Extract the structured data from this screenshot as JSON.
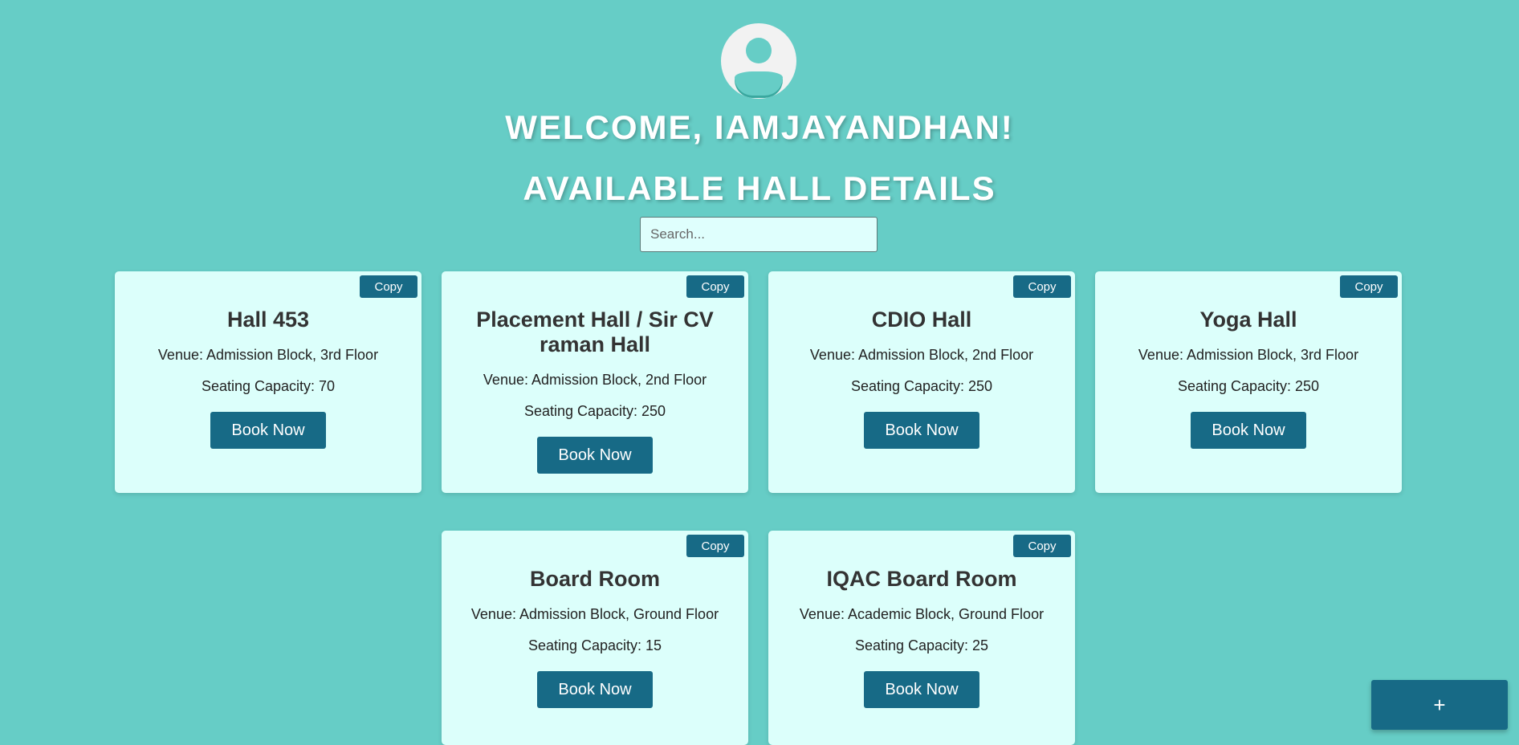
{
  "header": {
    "welcome": "WELCOME, IAMJAYANDHAN!",
    "subtitle": "AVAILABLE HALL DETAILS"
  },
  "search": {
    "placeholder": "Search...",
    "value": ""
  },
  "halls": [
    {
      "name": "Hall 453",
      "venue": "Venue: Admission Block, 3rd Floor",
      "capacity": "Seating Capacity: 70",
      "copy_label": "Copy",
      "book_label": "Book Now"
    },
    {
      "name": "Placement Hall / Sir CV raman Hall",
      "venue": "Venue: Admission Block, 2nd Floor",
      "capacity": "Seating Capacity: 250",
      "copy_label": "Copy",
      "book_label": "Book Now"
    },
    {
      "name": "CDIO Hall",
      "venue": "Venue: Admission Block, 2nd Floor",
      "capacity": "Seating Capacity: 250",
      "copy_label": "Copy",
      "book_label": "Book Now"
    },
    {
      "name": "Yoga Hall",
      "venue": "Venue: Admission Block, 3rd Floor",
      "capacity": "Seating Capacity: 250",
      "copy_label": "Copy",
      "book_label": "Book Now"
    },
    {
      "name": "Board Room",
      "venue": "Venue: Admission Block, Ground Floor",
      "capacity": "Seating Capacity: 15",
      "copy_label": "Copy",
      "book_label": "Book Now"
    },
    {
      "name": "IQAC Board Room",
      "venue": "Venue: Academic Block, Ground Floor",
      "capacity": "Seating Capacity: 25",
      "copy_label": "Copy",
      "book_label": "Book Now"
    }
  ],
  "fab": {
    "label": "+"
  },
  "colors": {
    "background": "#66cdc6",
    "card": "#dcfffb",
    "button": "#176a86"
  },
  "icons": {
    "avatar": "user-avatar-icon"
  }
}
